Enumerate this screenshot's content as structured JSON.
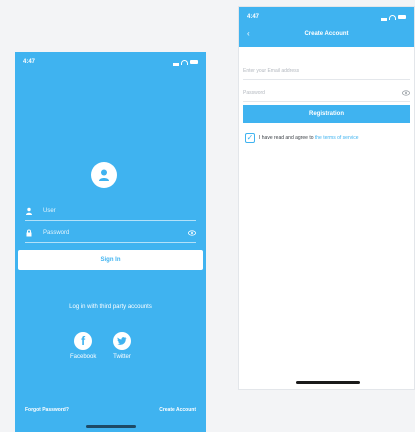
{
  "login": {
    "status_time": "4:47",
    "username_placeholder": "User",
    "password_placeholder": "Password",
    "sign_in_label": "Sign In",
    "third_party_label": "Log in with third party accounts",
    "facebook_label": "Facebook",
    "twitter_label": "Twitter",
    "forgot_password_label": "Forgot Password?",
    "create_account_label": "Create Account"
  },
  "register": {
    "status_time": "4:47",
    "title": "Create Account",
    "email_placeholder": "Enter your Email address",
    "password_placeholder": "Password",
    "registration_label": "Registration",
    "agree_text": "I have read and agree to ",
    "terms_link": "the terms of service"
  },
  "colors": {
    "accent": "#3fb3f0",
    "background": "#f3f4f6"
  }
}
